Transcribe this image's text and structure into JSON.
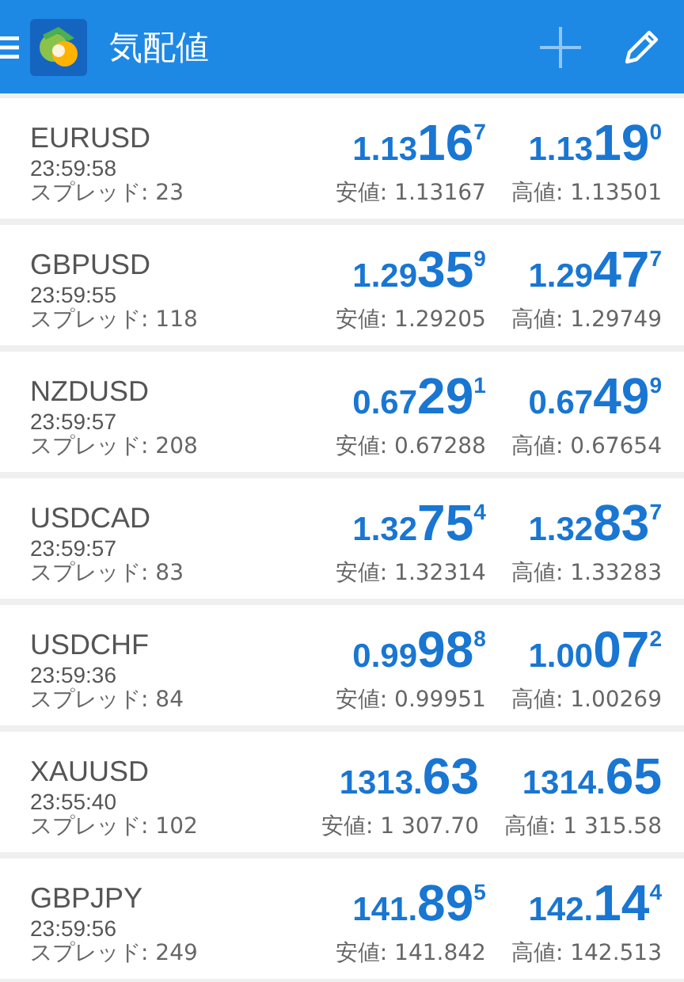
{
  "app_bar": {
    "title": "気配値"
  },
  "quotes": [
    {
      "symbol": "EURUSD",
      "time": "23:59:58",
      "spread": "スプレッド: 23",
      "bid": {
        "prefix": "1.13",
        "big": "16",
        "pip": "7"
      },
      "ask": {
        "prefix": "1.13",
        "big": "19",
        "pip": "0"
      },
      "low": "安値: 1.13167",
      "high": "高値: 1.13501"
    },
    {
      "symbol": "GBPUSD",
      "time": "23:59:55",
      "spread": "スプレッド: 118",
      "bid": {
        "prefix": "1.29",
        "big": "35",
        "pip": "9"
      },
      "ask": {
        "prefix": "1.29",
        "big": "47",
        "pip": "7"
      },
      "low": "安値: 1.29205",
      "high": "高値: 1.29749"
    },
    {
      "symbol": "NZDUSD",
      "time": "23:59:57",
      "spread": "スプレッド: 208",
      "bid": {
        "prefix": "0.67",
        "big": "29",
        "pip": "1"
      },
      "ask": {
        "prefix": "0.67",
        "big": "49",
        "pip": "9"
      },
      "low": "安値: 0.67288",
      "high": "高値: 0.67654"
    },
    {
      "symbol": "USDCAD",
      "time": "23:59:57",
      "spread": "スプレッド: 83",
      "bid": {
        "prefix": "1.32",
        "big": "75",
        "pip": "4"
      },
      "ask": {
        "prefix": "1.32",
        "big": "83",
        "pip": "7"
      },
      "low": "安値: 1.32314",
      "high": "高値: 1.33283"
    },
    {
      "symbol": "USDCHF",
      "time": "23:59:36",
      "spread": "スプレッド: 84",
      "bid": {
        "prefix": "0.99",
        "big": "98",
        "pip": "8"
      },
      "ask": {
        "prefix": "1.00",
        "big": "07",
        "pip": "2"
      },
      "low": "安値: 0.99951",
      "high": "高値: 1.00269"
    },
    {
      "symbol": "XAUUSD",
      "time": "23:55:40",
      "spread": "スプレッド: 102",
      "bid": {
        "prefix": "1313.",
        "big": "63"
      },
      "ask": {
        "prefix": "1314.",
        "big": "65"
      },
      "low": "安値: 1 307.70",
      "high": "高値: 1 315.58"
    },
    {
      "symbol": "GBPJPY",
      "time": "23:59:56",
      "spread": "スプレッド: 249",
      "bid": {
        "prefix": "141.",
        "big": "89",
        "pip": "5"
      },
      "ask": {
        "prefix": "142.",
        "big": "14",
        "pip": "4"
      },
      "low": "安値: 141.842",
      "high": "高値: 142.513"
    }
  ]
}
